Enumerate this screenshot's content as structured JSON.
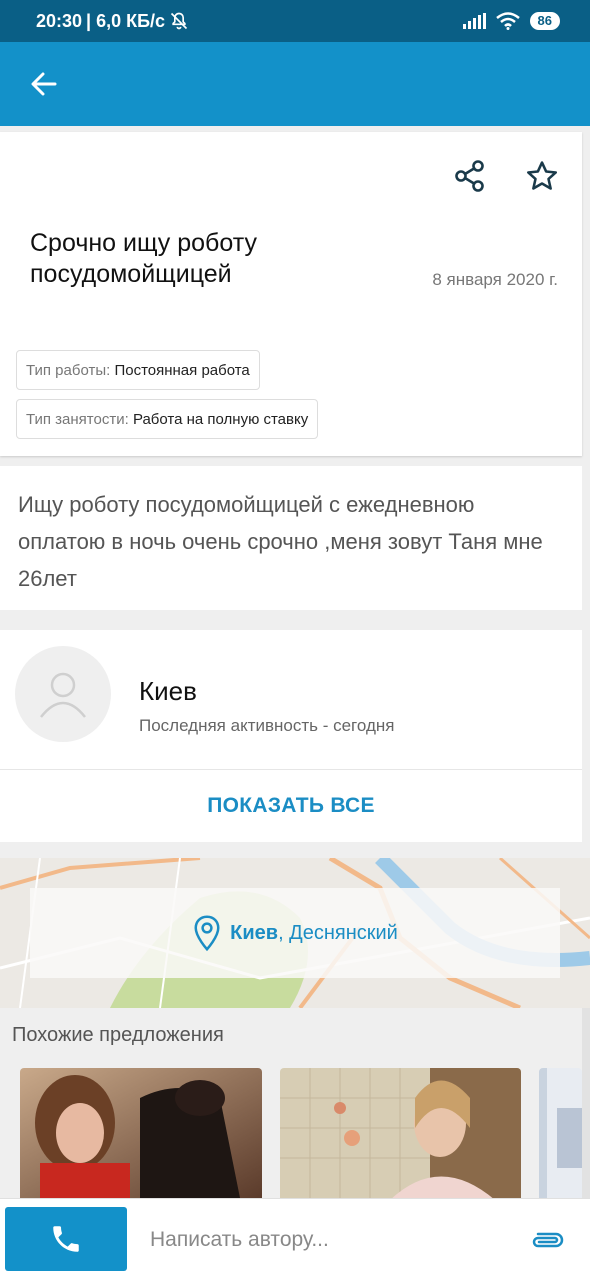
{
  "status_bar": {
    "time": "20:30",
    "network_speed": "| 6,0 КБ/с",
    "battery": "86"
  },
  "ad": {
    "title": "Срочно ищу роботу посудомойщицей",
    "date": "8 января 2020 г.",
    "attributes": [
      {
        "key": "Тип работы:",
        "value": "Постоянная работа"
      },
      {
        "key": "Тип занятости:",
        "value": "Работа на полную ставку"
      }
    ],
    "description": "Ищу роботу посудомойщицей с ежедневною оплатою в ночь очень срочно ,меня зовут Таня мне 26лет"
  },
  "author": {
    "city": "Киев",
    "last_activity": "Последняя активность - сегодня",
    "show_all_label": "ПОКАЗАТЬ ВСЕ"
  },
  "map": {
    "city": "Киев",
    "district": ", Деснянский"
  },
  "similar": {
    "title": "Похожие предложения"
  },
  "bottom_bar": {
    "message_placeholder": "Написать автору..."
  },
  "colors": {
    "app_bar": "#1391c9",
    "status_bar": "#0a5f86",
    "accent": "#1b8dc4"
  },
  "icons": [
    "arrow-back-icon",
    "share-icon",
    "star-outline-icon",
    "user-avatar-icon",
    "location-pin-icon",
    "phone-icon",
    "paperclip-icon",
    "wifi-icon",
    "signal-icon",
    "bell-off-icon"
  ]
}
